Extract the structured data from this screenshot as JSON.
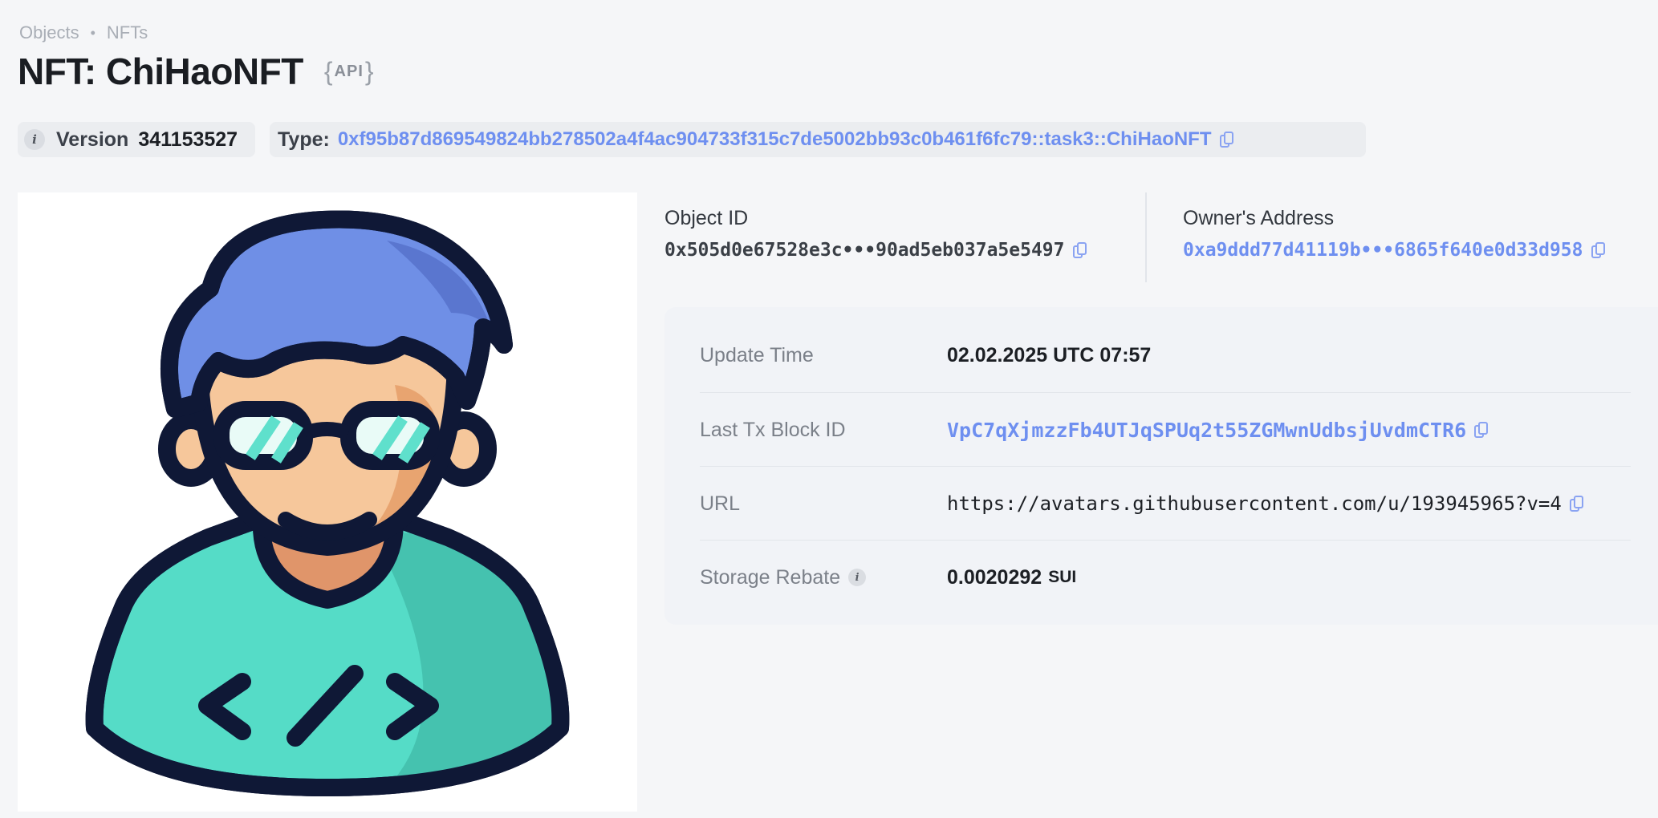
{
  "breadcrumb": {
    "items": [
      "Objects",
      "NFTs"
    ]
  },
  "header": {
    "title": "NFT: ChiHaoNFT",
    "api_label": "API",
    "api_open_brace": "{",
    "api_close_brace": "}"
  },
  "version_chip": {
    "icon": "info-icon",
    "label": "Version",
    "value": "341153527"
  },
  "type_chip": {
    "label": "Type:",
    "value": "0xf95b87d869549824bb278502a4f4ac904733f315c7de5002bb93c0b461f6fc79::task3::ChiHaoNFT",
    "icon": "copy-icon"
  },
  "object_id": {
    "label": "Object ID",
    "value": "0x505d0e67528e3c•••90ad5eb037a5e5497"
  },
  "owner": {
    "label": "Owner's Address",
    "value": "0xa9ddd77d41119b•••6865f640e0d33d958"
  },
  "details": {
    "update_time": {
      "label": "Update Time",
      "value": "02.02.2025 UTC 07:57"
    },
    "last_tx": {
      "label": "Last Tx Block ID",
      "value": "VpC7qXjmzzFb4UTJqSPUq2t55ZGMwnUdbsjUvdmCTR6"
    },
    "url": {
      "label": "URL",
      "value": "https://avatars.githubusercontent.com/u/193945965?v=4"
    },
    "storage_rebate": {
      "label": "Storage Rebate",
      "value": "0.0020292",
      "unit": "SUI"
    }
  },
  "colors": {
    "accent": "#6e8ff0",
    "hair": "#6f8fe6",
    "shirt": "#55dcc7",
    "skin": "#f6c79b",
    "outline": "#0f1836"
  }
}
